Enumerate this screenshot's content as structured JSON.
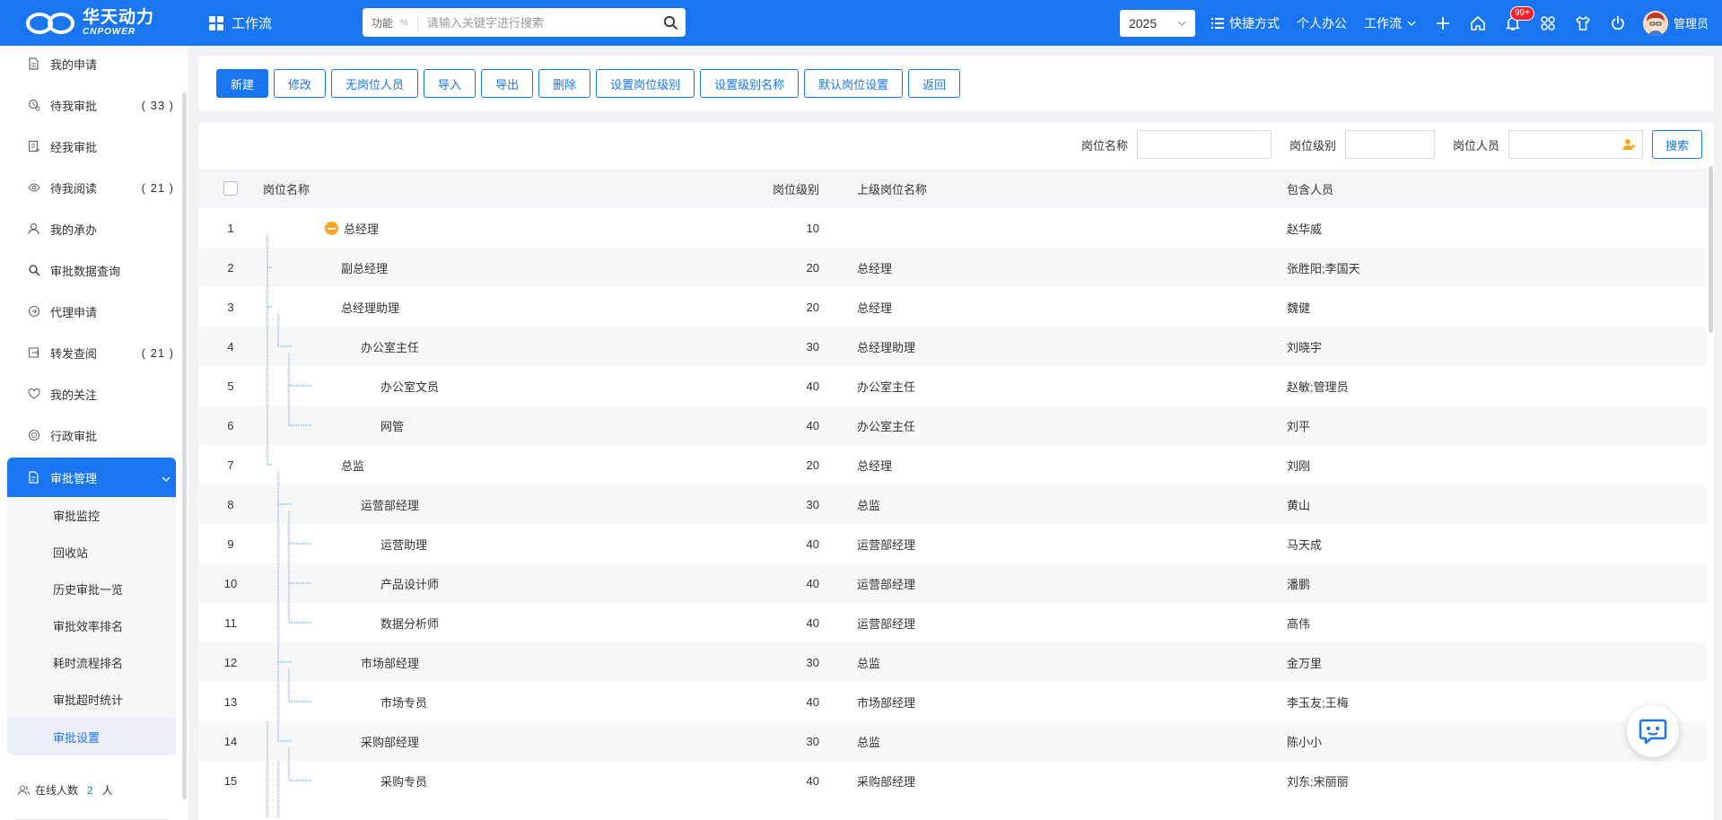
{
  "brand": {
    "name_cn": "华天动力",
    "name_en": "CNPOWER"
  },
  "app_switch": {
    "label": "工作流"
  },
  "search": {
    "scope": "功能",
    "scope_mark": "%",
    "placeholder": "请输入关键字进行搜索"
  },
  "header": {
    "year": "2025",
    "links": [
      "快捷方式",
      "个人办公",
      "工作流"
    ],
    "notification_badge": "99+",
    "user": "管理员"
  },
  "sidebar": {
    "items": [
      {
        "label": "我的申请",
        "count": "",
        "icon": "document-icon"
      },
      {
        "label": "待我审批",
        "count": "( 33 )",
        "icon": "clock-user-icon"
      },
      {
        "label": "经我审批",
        "count": "",
        "icon": "list-check-icon"
      },
      {
        "label": "待我阅读",
        "count": "( 21 )",
        "icon": "eye-icon"
      },
      {
        "label": "我的承办",
        "count": "",
        "icon": "person-icon"
      },
      {
        "label": "审批数据查询",
        "count": "",
        "icon": "search-data-icon"
      },
      {
        "label": "代理申请",
        "count": "",
        "icon": "proxy-icon"
      },
      {
        "label": "转发查阅",
        "count": "( 21 )",
        "icon": "forward-icon"
      },
      {
        "label": "我的关注",
        "count": "",
        "icon": "heart-icon"
      },
      {
        "label": "行政审批",
        "count": "",
        "icon": "admin-icon"
      }
    ],
    "active": {
      "label": "审批管理",
      "icon": "approval-manage-icon"
    },
    "sub_items": [
      "审批监控",
      "回收站",
      "历史审批一览",
      "审批效率排名",
      "耗时流程排名",
      "审批超时统计",
      "审批设置"
    ],
    "online": {
      "prefix": "在线人数",
      "count": "2",
      "suffix": "人"
    }
  },
  "toolbar": {
    "buttons": [
      "新建",
      "修改",
      "无岗位人员",
      "导入",
      "导出",
      "删除",
      "设置岗位级别",
      "设置级别名称",
      "默认岗位设置",
      "返回"
    ]
  },
  "filters": {
    "name_label": "岗位名称",
    "level_label": "岗位级别",
    "person_label": "岗位人员",
    "search_button": "搜索"
  },
  "table": {
    "headers": {
      "name": "岗位名称",
      "level": "岗位级别",
      "parent": "上级岗位名称",
      "people": "包含人员"
    },
    "rows": [
      {
        "idx": "1",
        "name": "总经理",
        "depth": 0,
        "level": "10",
        "parent": "",
        "people": "赵华威"
      },
      {
        "idx": "2",
        "name": "副总经理",
        "depth": 1,
        "level": "20",
        "parent": "总经理",
        "people": "张胜阳;李国天"
      },
      {
        "idx": "3",
        "name": "总经理助理",
        "depth": 1,
        "level": "20",
        "parent": "总经理",
        "people": "魏健"
      },
      {
        "idx": "4",
        "name": "办公室主任",
        "depth": 2,
        "level": "30",
        "parent": "总经理助理",
        "people": "刘晓宇"
      },
      {
        "idx": "5",
        "name": "办公室文员",
        "depth": 3,
        "level": "40",
        "parent": "办公室主任",
        "people": "赵敏;管理员"
      },
      {
        "idx": "6",
        "name": "网管",
        "depth": 3,
        "level": "40",
        "parent": "办公室主任",
        "people": "刘平"
      },
      {
        "idx": "7",
        "name": "总监",
        "depth": 1,
        "level": "20",
        "parent": "总经理",
        "people": "刘刚"
      },
      {
        "idx": "8",
        "name": "运营部经理",
        "depth": 2,
        "level": "30",
        "parent": "总监",
        "people": "黄山"
      },
      {
        "idx": "9",
        "name": "运营助理",
        "depth": 3,
        "level": "40",
        "parent": "运营部经理",
        "people": "马天成"
      },
      {
        "idx": "10",
        "name": "产品设计师",
        "depth": 3,
        "level": "40",
        "parent": "运营部经理",
        "people": "潘鹏"
      },
      {
        "idx": "11",
        "name": "数据分析师",
        "depth": 3,
        "level": "40",
        "parent": "运营部经理",
        "people": "高伟"
      },
      {
        "idx": "12",
        "name": "市场部经理",
        "depth": 2,
        "level": "30",
        "parent": "总监",
        "people": "金万里"
      },
      {
        "idx": "13",
        "name": "市场专员",
        "depth": 3,
        "level": "40",
        "parent": "市场部经理",
        "people": "李玉友;王梅"
      },
      {
        "idx": "14",
        "name": "采购部经理",
        "depth": 2,
        "level": "30",
        "parent": "总监",
        "people": "陈小小"
      },
      {
        "idx": "15",
        "name": "采购专员",
        "depth": 3,
        "level": "40",
        "parent": "采购部经理",
        "people": "刘东;宋丽丽"
      }
    ]
  },
  "colors": {
    "primary": "#1976f0",
    "collapse_icon": "#f5a623",
    "badge": "#f5222d"
  }
}
